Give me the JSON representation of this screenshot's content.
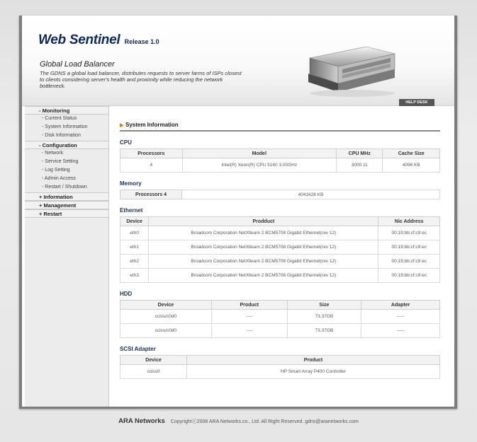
{
  "header": {
    "app_name": "Web Sentinel",
    "release": "Release 1.0",
    "product_title": "Global Load Balancer",
    "product_desc": "The GDNS a global load balancer, distributes requests to server farms of ISPs closest to clients considering server's health and proximity while reducing the network bottleneck.",
    "help_desk": "HELP DESK"
  },
  "sidebar": {
    "groups": [
      {
        "label": "- Monitoring",
        "items": [
          "- Current Status",
          "- System Information",
          "- Disk Information"
        ]
      },
      {
        "label": "- Configuration",
        "items": [
          "- Network",
          "- Service Setting",
          "- Log Setting",
          "- Admin Access",
          "- Restart / Shutdown"
        ]
      },
      {
        "label": "+ Information",
        "items": []
      },
      {
        "label": "+ Management",
        "items": []
      },
      {
        "label": "+ Restart",
        "items": []
      }
    ]
  },
  "main": {
    "title": "System Information",
    "cpu": {
      "title": "CPU",
      "headers": [
        "Processors",
        "Model",
        "CPU MHz",
        "Cache Size"
      ],
      "rows": [
        [
          "4",
          "Intel(R) Xeon(R) CPU 5160 3.00GHz",
          "3000.11",
          "4096 KB"
        ]
      ]
    },
    "memory": {
      "title": "Memory",
      "label": "Processors 4",
      "value": "4041628 KB"
    },
    "ethernet": {
      "title": "Ethernet",
      "headers": [
        "Device",
        "Prodduct",
        "Nic Address"
      ],
      "rows": [
        [
          "eth0",
          "Broadcom Corporation NetXtleam 2 BCM5708 Gigabit Ethernet(rev 12)",
          "00:19:bb:cf:c9:ec"
        ],
        [
          "eth1",
          "Broadcom Corporation NetXtleam 2 BCM5708 Gigabit Ethernet(rev 12)",
          "00:19:bb:cf:c9:ec"
        ],
        [
          "eth2",
          "Broadcom Corporation NetXtleam 2 BCM5708 Gigabit Ethernet(rev 12)",
          "00:19:bb:cf:c9:ec"
        ],
        [
          "eth3",
          "Broadcom Corporation NetXtleam 2 BCM5708 Gigabit Ethernet(rev 12)",
          "00:19:bb:cf:c9:ec"
        ]
      ]
    },
    "hdd": {
      "title": "HDD",
      "headers": [
        "Device",
        "Product",
        "Size",
        "Adapter"
      ],
      "rows": [
        [
          "cciss/c0d0",
          "----",
          "73.37GB",
          "-----"
        ],
        [
          "cciss/c0d0",
          "----",
          "73.37GB",
          "-----"
        ]
      ]
    },
    "scsi": {
      "title": "SCSI Adapter",
      "headers": [
        "Device",
        "Product"
      ],
      "rows": [
        [
          "cciss0",
          "HP Smart Array P400 Controller"
        ]
      ]
    }
  },
  "footer": {
    "brand": "ARA Networks",
    "copyright": "Copyrightⓒ2008 ARA Networks.co., Ltd. All Right Reserved. gdns@aranetworks.com"
  },
  "colors": {
    "accent": "#0d2a5c",
    "arrow": "#e07a00",
    "sidebar_bg": "#ececec"
  },
  "icons": {
    "title_arrow": "triangle-right-icon",
    "server": "rack-server-icon"
  }
}
